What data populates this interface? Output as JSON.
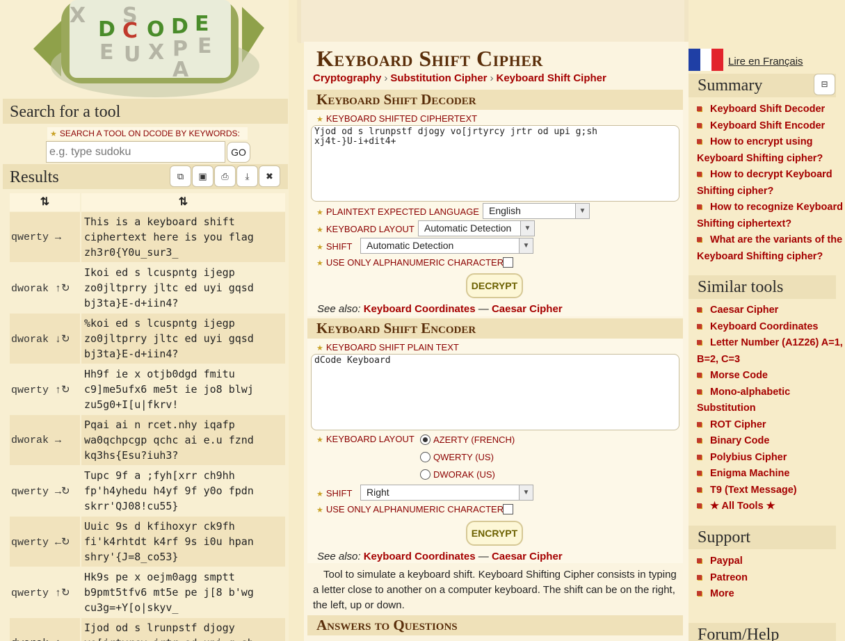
{
  "logo": {
    "letters": [
      "D",
      "C",
      "O",
      "D",
      "E"
    ],
    "decoy_letters": [
      "X",
      "S",
      "E",
      "U",
      "X",
      "P",
      "E",
      "A"
    ]
  },
  "left": {
    "search_title": "Search for a tool",
    "search_label": "SEARCH A TOOL ON DCODE BY KEYWORDS:",
    "search_placeholder": "e.g. type sudoku",
    "go": "GO",
    "results_title": "Results",
    "tools": [
      "⧉",
      "▣",
      "⎙",
      "⤓",
      "✖"
    ],
    "headers": [
      "⇅",
      "⇅"
    ],
    "rows": [
      {
        "k": "qwerty →",
        "v": "This is a keyboard shift\nciphertext here is you flag\nzh3r0{Y0u_sur3_"
      },
      {
        "k": "dworak ↑↻",
        "v": "Ikoi ed s lcuspntg ijegp\nzo0jltprry jltc ed uyi gqsd\nbj3ta}E-d+iin4?"
      },
      {
        "k": "dworak ↓↻",
        "v": "%koi ed s lcuspntg ijegp\nzo0jltprry jltc ed uyi gqsd\nbj3ta}E-d+iin4?"
      },
      {
        "k": "qwerty ↑↻",
        "v": "Hh9f ie x otjb0dgd fmitu\nc9]me5ufx6 me5t ie jo8 blwj\nzu5g0+I[u|fkrv!"
      },
      {
        "k": "dworak →",
        "v": "Pqai ai n rcet.nhy iqafp\nwa0qchpcgp qchc ai e.u fznd\nkq3hs{Esu?iuh3?"
      },
      {
        "k": "qwerty →↻",
        "v": "Tupc 9f a ;fyh[xrr ch9hh\nfp'h4yhedu h4yf 9f y0o fpdn\nskrr'QJ08!cu55}"
      },
      {
        "k": "qwerty ←↻",
        "v": "Uuic 9s d kfihoxyr ck9fh\nfi'k4rhtdt k4rf 9s i0u hpan\nshry'{J=8_co53}"
      },
      {
        "k": "qwerty ↑↻",
        "v": "Hk9s pe x oejm0agg smptt\nb9pmt5tfv6 mt5e pe j[8 b'wg\ncu3g=+Y[o|skyv_"
      },
      {
        "k": "dworak ↑",
        "v": "Ijod od s lrunpstf djogy\nvo[jrtyrcy jrtr od upi g;sh"
      }
    ]
  },
  "main": {
    "title": "Keyboard Shift Cipher",
    "crumbs": [
      "Cryptography",
      "Substitution Cipher",
      "Keyboard Shift Cipher"
    ],
    "decoder": {
      "title": "Keyboard Shift Decoder",
      "cipher_label": "KEYBOARD SHIFTED CIPHERTEXT",
      "cipher_value": "Yjod od s lrunpstf djogy vo[jrtyrcy jrtr od upi g;sh\nxj4t-}U-i+dit4+",
      "lang_label": "PLAINTEXT EXPECTED LANGUAGE",
      "lang_value": "English",
      "layout_label": "KEYBOARD LAYOUT",
      "layout_value": "Automatic Detection",
      "shift_label": "SHIFT",
      "shift_value": "Automatic Detection",
      "alnum_label": "USE ONLY ALPHANUMERIC CHARACTERS",
      "button": "DECRYPT",
      "see_also": "See also:",
      "links": [
        "Keyboard Coordinates",
        "Caesar Cipher"
      ],
      "dash": "—"
    },
    "encoder": {
      "title": "Keyboard Shift Encoder",
      "plain_label": "KEYBOARD SHIFT PLAIN TEXT",
      "plain_value": "dCode Keyboard",
      "layout_label": "KEYBOARD LAYOUT",
      "layouts": [
        "AZERTY (FRENCH)",
        "QWERTY (US)",
        "DWORAK (US)"
      ],
      "shift_label": "SHIFT",
      "shift_value": "Right",
      "alnum_label": "USE ONLY ALPHANUMERIC CHARACTERS",
      "button": "ENCRYPT"
    },
    "description": "Tool to simulate a keyboard shift. Keyboard Shifting Cipher consists in typing a letter close to another on a computer keyboard. The shift can be on the right, the left, up or down.",
    "answers_title": "Answers to Questions"
  },
  "right": {
    "lang_link": "Lire en Français",
    "summary_title": "Summary",
    "minimize_icon": "⊟",
    "summary": [
      "Keyboard Shift Decoder",
      "Keyboard Shift Encoder",
      "How to encrypt using Keyboard Shifting cipher?",
      "How to decrypt Keyboard Shifting cipher?",
      "How to recognize Keyboard Shifting ciphertext?",
      "What are the variants of the Keyboard Shifting cipher?"
    ],
    "similar_title": "Similar tools",
    "similar": [
      "Caesar Cipher",
      "Keyboard Coordinates",
      "Letter Number (A1Z26) A=1, B=2, C=3",
      "Morse Code",
      "Mono-alphabetic Substitution",
      "ROT Cipher",
      "Binary Code",
      "Polybius Cipher",
      "Enigma Machine",
      "T9 (Text Message)",
      "★ All Tools ★"
    ],
    "support_title": "Support",
    "support": [
      "Paypal",
      "Patreon",
      "More"
    ],
    "forum_title": "Forum/Help"
  }
}
